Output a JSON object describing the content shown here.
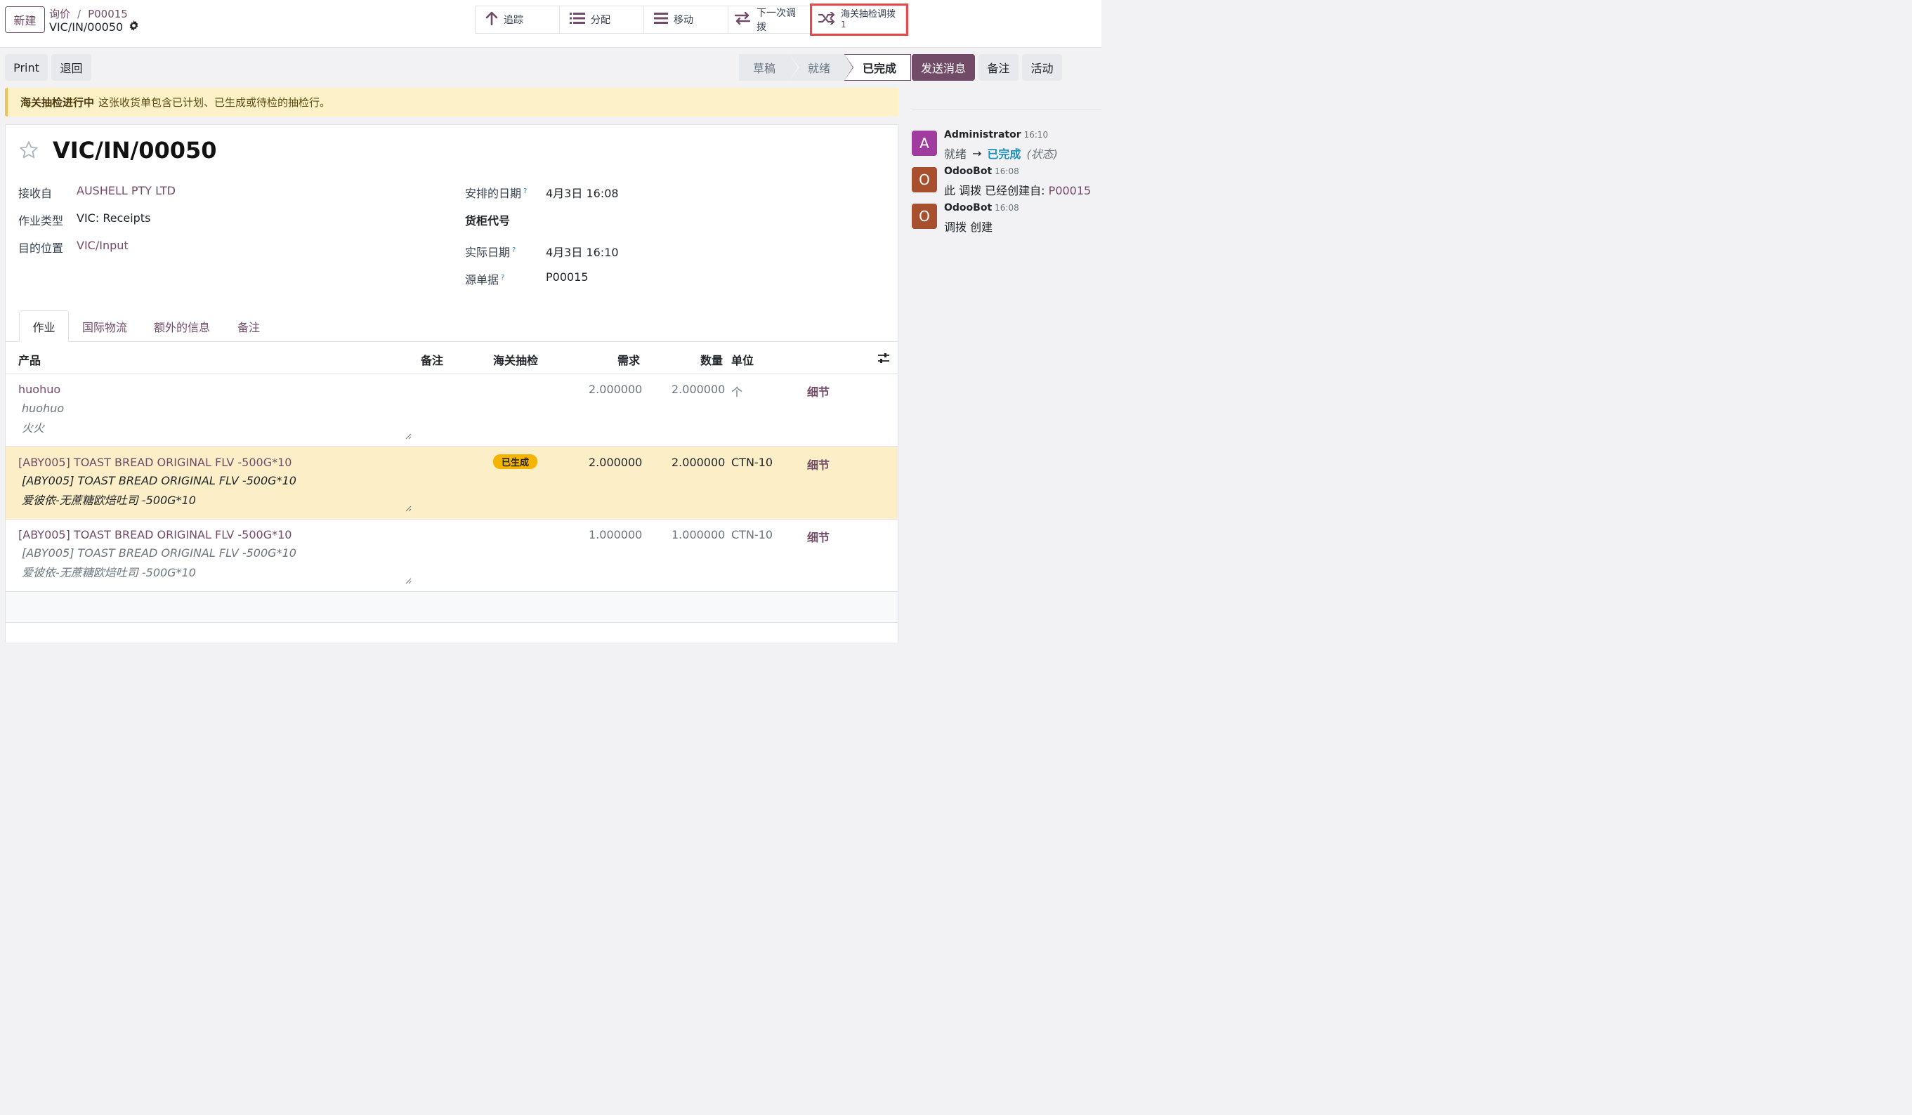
{
  "control_panel": {
    "new_button": "新建",
    "breadcrumb": {
      "parent": "询价",
      "separator": "/",
      "record": "P00015"
    },
    "title": "VIC/IN/00050",
    "smart_buttons": [
      {
        "label": "追踪",
        "icon": "arrow-up-icon"
      },
      {
        "label": "分配",
        "icon": "list-icon"
      },
      {
        "label": "移动",
        "icon": "bars-icon"
      },
      {
        "label": "下一次调拨",
        "icon": "exchange-icon"
      },
      {
        "label": "海关抽检调拨",
        "count": "1",
        "icon": "shuffle-icon"
      }
    ]
  },
  "action_buttons": {
    "print": "Print",
    "return": "退回"
  },
  "status_bar": {
    "stages": [
      "草稿",
      "就绪",
      "已完成"
    ],
    "current": "已完成"
  },
  "chatter_buttons": {
    "send_message": "发送消息",
    "note": "备注",
    "activity": "活动"
  },
  "alert": {
    "title": "海关抽检进行中",
    "text": "这张收货单包含已计划、已生成或待检的抽检行。"
  },
  "form": {
    "name": "VIC/IN/00050",
    "left_fields": [
      {
        "label": "接收自",
        "value": "AUSHELL PTY LTD"
      },
      {
        "label": "作业类型",
        "value": "VIC: Receipts"
      },
      {
        "label": "目的位置",
        "value": "VIC/Input"
      }
    ],
    "right_fields": [
      {
        "label": "安排的日期",
        "help": "?",
        "value": "4月3日 16:08"
      },
      {
        "label": "货柜代号",
        "value": ""
      },
      {
        "label": "实际日期",
        "help": "?",
        "value": "4月3日 16:10"
      },
      {
        "label": "源单据",
        "help": "?",
        "value": "P00015"
      }
    ]
  },
  "tabs": [
    "作业",
    "国际物流",
    "额外的信息",
    "备注"
  ],
  "table": {
    "headers": [
      "产品",
      "备注",
      "海关抽检",
      "需求",
      "数量",
      "单位"
    ],
    "rows": [
      {
        "product": "huohuo",
        "desc1": "huohuo",
        "desc2": "火火",
        "inspection": "",
        "demand": "2.000000",
        "quantity": "2.000000",
        "uom": "个",
        "detail": "细节"
      },
      {
        "product": "[ABY005] TOAST BREAD ORIGINAL FLV -500G*10",
        "desc1": "[ABY005] TOAST BREAD ORIGINAL FLV -500G*10",
        "desc2": "爱彼依-无蔗糖欧焙吐司 -500G*10",
        "inspection": "已生成",
        "demand": "2.000000",
        "quantity": "2.000000",
        "uom": "CTN-10",
        "detail": "细节"
      },
      {
        "product": "[ABY005] TOAST BREAD ORIGINAL FLV -500G*10",
        "desc1": "[ABY005] TOAST BREAD ORIGINAL FLV -500G*10",
        "desc2": "爱彼依-无蔗糖欧焙吐司 -500G*10",
        "inspection": "",
        "demand": "1.000000",
        "quantity": "1.000000",
        "uom": "CTN-10",
        "detail": "细节"
      }
    ]
  },
  "chatter": {
    "messages": [
      {
        "initial": "A",
        "author": "Administrator",
        "time": "16:10",
        "from": "就绪",
        "arrow": "→",
        "to": "已完成",
        "field": "(状态)",
        "color": "#a03c9f"
      },
      {
        "initial": "O",
        "author": "OdooBot",
        "time": "16:08",
        "text": "此 调拨 已经创建自:",
        "link": "P00015",
        "color": "#a8502e"
      },
      {
        "initial": "O",
        "author": "OdooBot",
        "time": "16:08",
        "text": "调拨 创建",
        "color": "#a8502e"
      }
    ]
  },
  "colors": {
    "primary": "#714b67",
    "alert_bg": "#fdf1c7",
    "highlight_row": "#fcefc8",
    "badge": "#f5b400",
    "red_outline": "#e44a4a"
  }
}
